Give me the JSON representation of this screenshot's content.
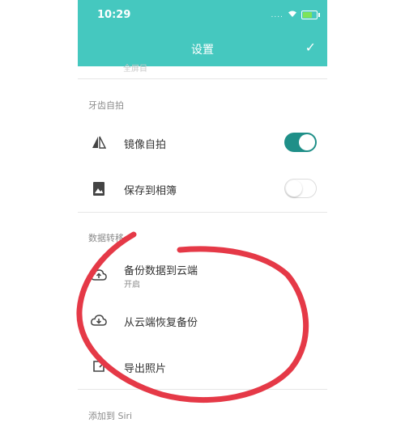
{
  "status_bar": {
    "time": "10:29",
    "signal": "....",
    "battery_level": 0.7
  },
  "header": {
    "title": "设置",
    "confirm_icon": "check-icon",
    "background": "#45c8bf"
  },
  "clipped_row_text": "全屏目",
  "sections": [
    {
      "title": "牙齿自拍",
      "items": [
        {
          "label": "镜像自拍",
          "icon": "mirror-icon",
          "toggle": true
        },
        {
          "label": "保存到相簿",
          "icon": "photo-album-icon",
          "toggle": false
        }
      ]
    },
    {
      "title": "数据转移",
      "items": [
        {
          "label": "备份数据到云端",
          "sublabel": "开启",
          "icon": "cloud-upload-icon"
        },
        {
          "label": "从云端恢复备份",
          "icon": "cloud-download-icon"
        },
        {
          "label": "导出照片",
          "icon": "export-icon"
        }
      ]
    },
    {
      "title": "添加到 Siri"
    }
  ],
  "colors": {
    "accent": "#1f8f88",
    "annotation": "#e53947"
  }
}
